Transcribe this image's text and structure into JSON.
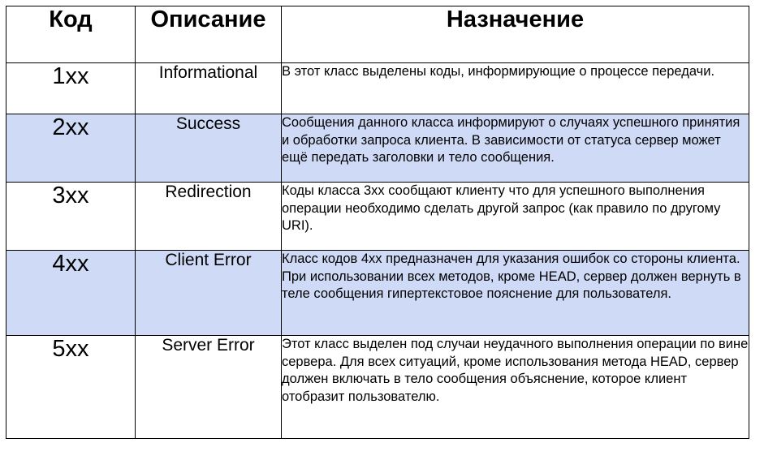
{
  "table": {
    "headers": {
      "code": "Код",
      "description": "Описание",
      "purpose": "Назначение"
    },
    "rows": [
      {
        "code": "1xx",
        "description": "Informational",
        "purpose": "В этот класс выделены коды, информирующие о процессе передачи."
      },
      {
        "code": "2xx",
        "description": "Success",
        "purpose": "Сообщения данного класса информируют о случаях успешного принятия и обработки запроса клиента. В зависимости от статуса сервер может ещё передать заголовки и тело сообщения."
      },
      {
        "code": "3xx",
        "description": "Redirection",
        "purpose": "Коды класса 3xx сообщают клиенту что для успешного выполнения операции необходимо сделать другой запрос (как правило по другому URI)."
      },
      {
        "code": "4xx",
        "description": "Client Error",
        "purpose": "Класс кодов 4xx предназначен для указания ошибок со стороны клиента. При использовании всех методов, кроме HEAD, сервер должен вернуть в теле сообщения гипертекстовое пояснение для пользователя."
      },
      {
        "code": "5xx",
        "description": "Server Error",
        "purpose": "Этот класс выделен под случаи неудачного выполнения операции по вине сервера. Для всех ситуаций, кроме использования метода HEAD, сервер должен включать в тело сообщения объяснение, которое клиент отобразит пользователю."
      }
    ]
  },
  "colors": {
    "alt_row_background": "#cfdaf6",
    "border": "#000000"
  }
}
